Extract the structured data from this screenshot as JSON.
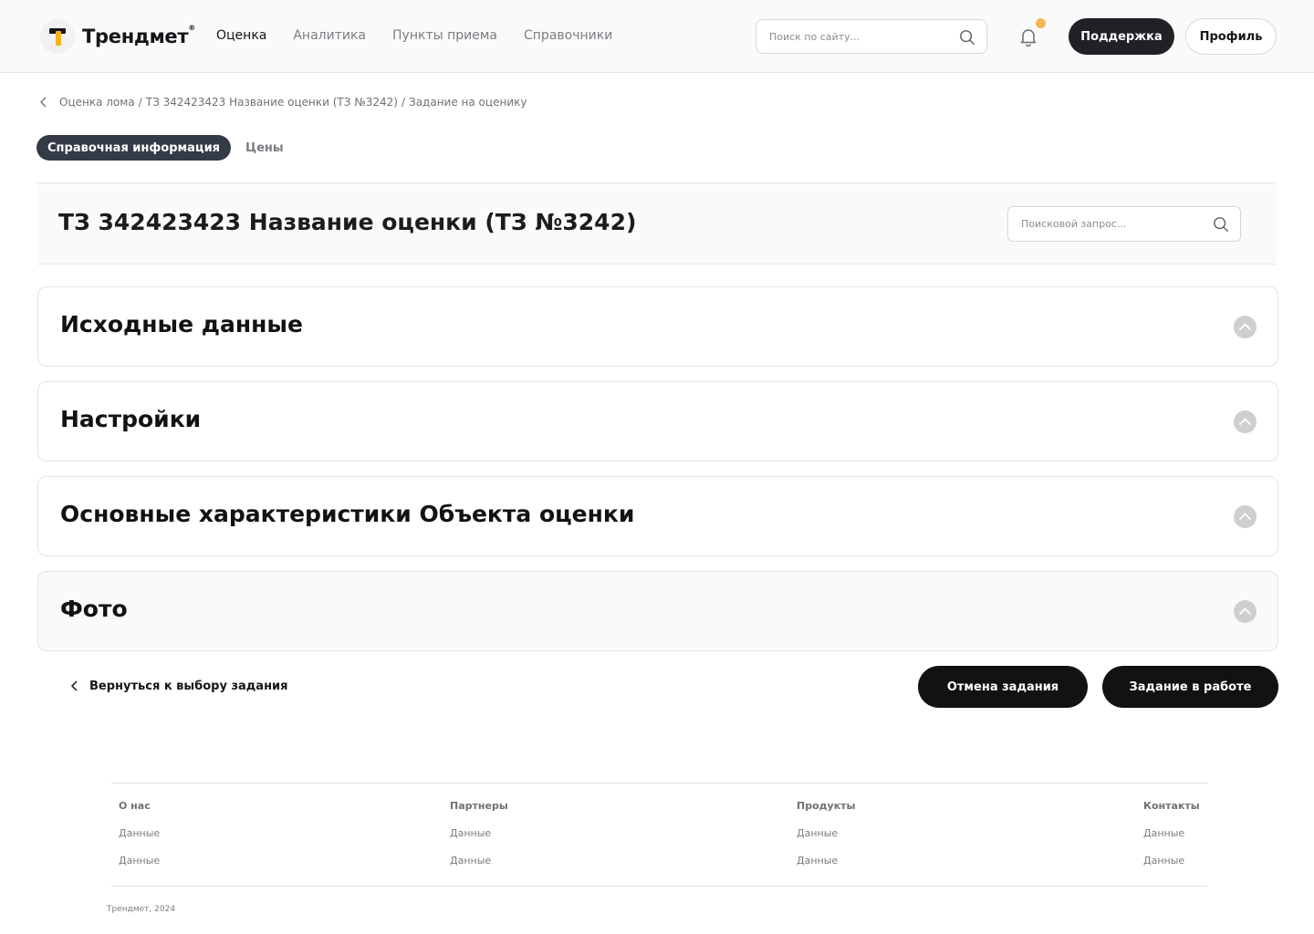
{
  "header": {
    "logo_text": "Трендмет",
    "logo_sup": "®",
    "nav": [
      {
        "label": "Оценка"
      },
      {
        "label": "Аналитика"
      },
      {
        "label": "Пункты приема"
      },
      {
        "label": "Справочники"
      }
    ],
    "search_placeholder": "Поиск по сайту...",
    "support_label": "Поддержка",
    "profile_label": "Профиль",
    "notification_dot_color": "#f4b654"
  },
  "breadcrumb": {
    "items": [
      "Оценка лома",
      "ТЗ 342423423 Название оценки (ТЗ №3242)",
      "Задание на оценику"
    ],
    "separator": "/"
  },
  "tabs": [
    {
      "label": "Справочная информация"
    },
    {
      "label": "Цены"
    }
  ],
  "main": {
    "title": "ТЗ 342423423 Название оценки (ТЗ №3242)",
    "search_placeholder": "Поисковой запрос...",
    "sections": [
      {
        "title": "Исходные данные"
      },
      {
        "title": "Настройки"
      },
      {
        "title": "Основные характеристики Объекта оценки"
      },
      {
        "title": "Фото"
      }
    ]
  },
  "actions": {
    "back_label": "Вернуться к выбору задания",
    "cancel_label": "Отмена задания",
    "in_work_label": "Задание в работе"
  },
  "footer": {
    "columns": [
      {
        "heading": "О нас",
        "links": [
          "Данные",
          "Данные"
        ]
      },
      {
        "heading": "Партнеры",
        "links": [
          "Данные",
          "Данные"
        ]
      },
      {
        "heading": "Продукты",
        "links": [
          "Данные",
          "Данные"
        ]
      },
      {
        "heading": "Контакты",
        "links": [
          "Данные",
          "Данные"
        ]
      }
    ],
    "copyright": "Трендмет, 2024"
  },
  "colors": {
    "accent": "#f4b41a",
    "dark": "#111214",
    "tab_active": "#343a46"
  }
}
